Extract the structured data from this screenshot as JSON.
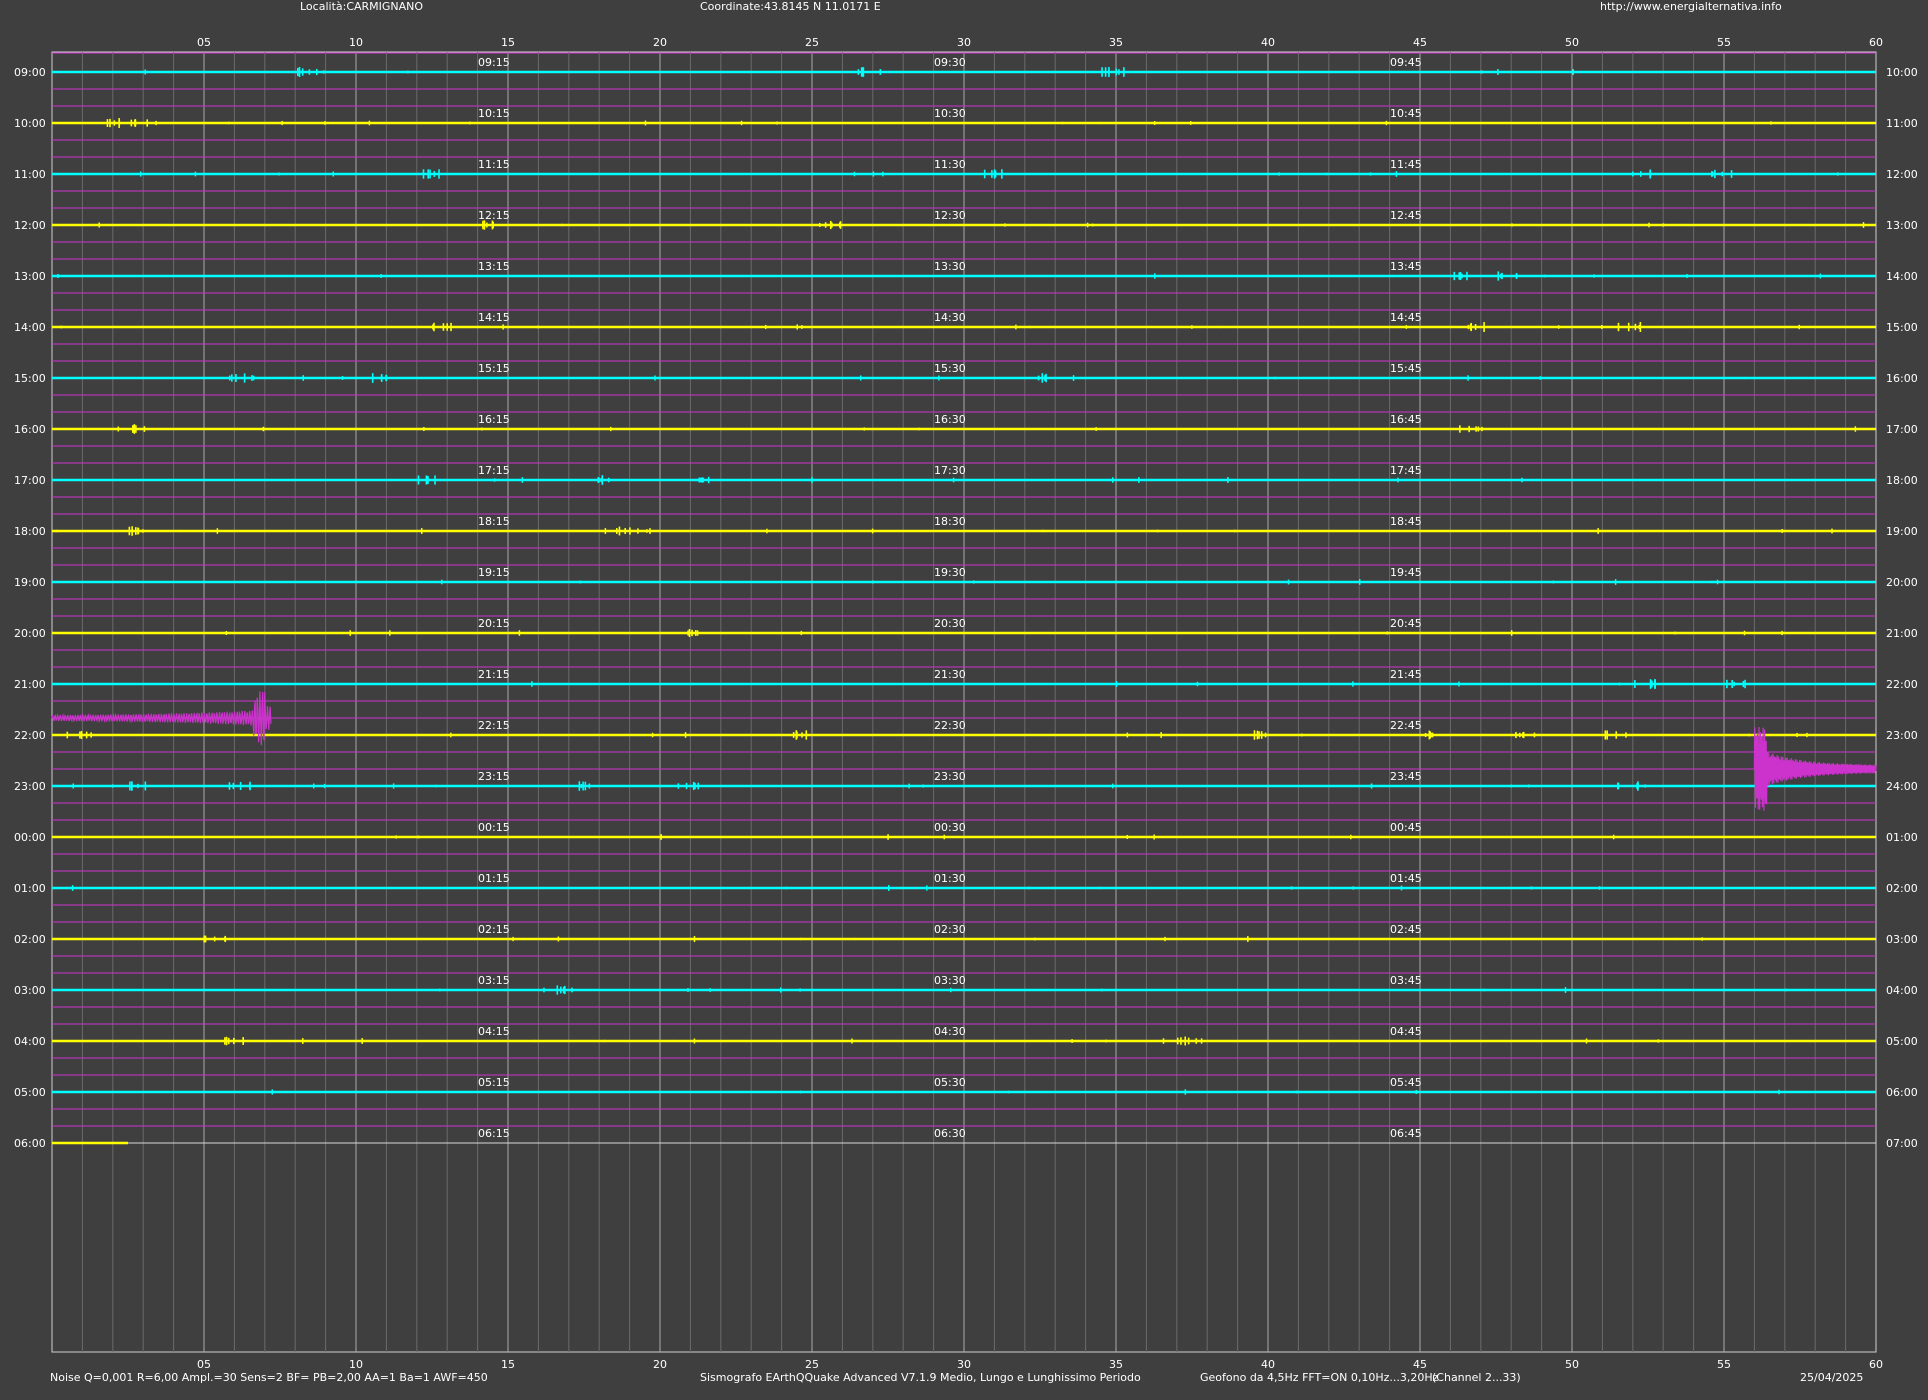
{
  "header": {
    "location": "Località:CARMIGNANO",
    "coordinates": "Coordinate:43.8145 N 11.0171 E",
    "url": "http://www.energialternativa.info"
  },
  "footer": {
    "params": "Noise Q=0,001 R=6,00 Ampl.=30 Sens=2 BF= PB=2,00 AA=1 Ba=1 AWF=450",
    "software": "Sismografo  EArthQQuake Advanced V7.1.9  Medio, Lungo e Lunghissimo Periodo",
    "sensor": "Geofono da 4,5Hz FFT=ON 0,10Hz...3,20Hz",
    "channel": "(Channel 2...33)",
    "date": "25/04/2025"
  },
  "colors": {
    "background": "#3f3f3f",
    "cyan_trace": "#00ffff",
    "yellow_trace": "#ffff00",
    "magenta_trace": "#cc33cc",
    "grid": "#888888",
    "text": "#ffffff"
  },
  "chart_data": {
    "type": "line",
    "x_ticks": [
      "05",
      "10",
      "15",
      "20",
      "25",
      "30",
      "35",
      "40",
      "45",
      "50",
      "55",
      "60"
    ],
    "xlim": [
      0,
      60
    ],
    "grid": true,
    "rows": [
      {
        "left": "09:00",
        "right": "10:00",
        "q": [
          "09:15",
          "09:30",
          "09:45"
        ],
        "color": "cyan"
      },
      {
        "left": "10:00",
        "right": "11:00",
        "q": [
          "10:15",
          "10:30",
          "10:45"
        ],
        "color": "yellow"
      },
      {
        "left": "11:00",
        "right": "12:00",
        "q": [
          "11:15",
          "11:30",
          "11:45"
        ],
        "color": "cyan"
      },
      {
        "left": "12:00",
        "right": "13:00",
        "q": [
          "12:15",
          "12:30",
          "12:45"
        ],
        "color": "yellow"
      },
      {
        "left": "13:00",
        "right": "14:00",
        "q": [
          "13:15",
          "13:30",
          "13:45"
        ],
        "color": "cyan"
      },
      {
        "left": "14:00",
        "right": "15:00",
        "q": [
          "14:15",
          "14:30",
          "14:45"
        ],
        "color": "yellow"
      },
      {
        "left": "15:00",
        "right": "16:00",
        "q": [
          "15:15",
          "15:30",
          "15:45"
        ],
        "color": "cyan"
      },
      {
        "left": "16:00",
        "right": "17:00",
        "q": [
          "16:15",
          "16:30",
          "16:45"
        ],
        "color": "yellow"
      },
      {
        "left": "17:00",
        "right": "18:00",
        "q": [
          "17:15",
          "17:30",
          "17:45"
        ],
        "color": "cyan"
      },
      {
        "left": "18:00",
        "right": "19:00",
        "q": [
          "18:15",
          "18:30",
          "18:45"
        ],
        "color": "yellow"
      },
      {
        "left": "19:00",
        "right": "20:00",
        "q": [
          "19:15",
          "19:30",
          "19:45"
        ],
        "color": "cyan"
      },
      {
        "left": "20:00",
        "right": "21:00",
        "q": [
          "20:15",
          "20:30",
          "20:45"
        ],
        "color": "yellow"
      },
      {
        "left": "21:00",
        "right": "22:00",
        "q": [
          "21:15",
          "21:30",
          "21:45"
        ],
        "color": "cyan"
      },
      {
        "left": "22:00",
        "right": "23:00",
        "q": [
          "22:15",
          "22:30",
          "22:45"
        ],
        "color": "yellow"
      },
      {
        "left": "23:00",
        "right": "24:00",
        "q": [
          "23:15",
          "23:30",
          "23:45"
        ],
        "color": "cyan"
      },
      {
        "left": "00:00",
        "right": "01:00",
        "q": [
          "00:15",
          "00:30",
          "00:45"
        ],
        "color": "yellow"
      },
      {
        "left": "01:00",
        "right": "02:00",
        "q": [
          "01:15",
          "01:30",
          "01:45"
        ],
        "color": "cyan"
      },
      {
        "left": "02:00",
        "right": "03:00",
        "q": [
          "02:15",
          "02:30",
          "02:45"
        ],
        "color": "yellow"
      },
      {
        "left": "03:00",
        "right": "04:00",
        "q": [
          "03:15",
          "03:30",
          "03:45"
        ],
        "color": "cyan"
      },
      {
        "left": "04:00",
        "right": "05:00",
        "q": [
          "04:15",
          "04:30",
          "04:45"
        ],
        "color": "yellow"
      },
      {
        "left": "05:00",
        "right": "06:00",
        "q": [
          "05:15",
          "05:30",
          "05:45"
        ],
        "color": "cyan"
      },
      {
        "left": "06:00",
        "right": "07:00",
        "q": [
          "06:15",
          "06:30",
          "06:45"
        ],
        "color": "yellow",
        "end_minute": 2.5
      }
    ],
    "events": [
      {
        "hour": "21:00",
        "start_minute": 0,
        "peak_minute": 7,
        "end_minute": 7.2
      },
      {
        "hour": "22:00",
        "start_minute": 56,
        "peak_minute": 56.1,
        "end_minute": 60
      }
    ],
    "burst_activity": {
      "09:00": [
        26.5,
        34.5,
        8
      ],
      "10:00": [
        1.5,
        2.5
      ],
      "11:00": [
        12.2,
        30.5,
        52,
        54.5
      ],
      "12:00": [
        13.8,
        25.2
      ],
      "13:00": [
        46,
        47.5
      ],
      "14:00": [
        12.5,
        46.5,
        51.5
      ],
      "15:00": [
        5.8,
        10.5,
        32
      ],
      "16:00": [
        2.5,
        46.3
      ],
      "17:00": [
        12,
        17.8,
        21
      ],
      "18:00": [
        2.5,
        18.5
      ],
      "20:00": [
        20.5
      ],
      "21:00": [
        52,
        55
      ],
      "22:00": [
        0.5,
        24.2,
        39.5,
        45,
        48,
        51
      ],
      "23:00": [
        2.5,
        5.8,
        17,
        20.5,
        51.5
      ],
      "02:00": [
        5
      ],
      "03:00": [
        16.5
      ],
      "04:00": [
        5.5,
        37
      ]
    }
  }
}
